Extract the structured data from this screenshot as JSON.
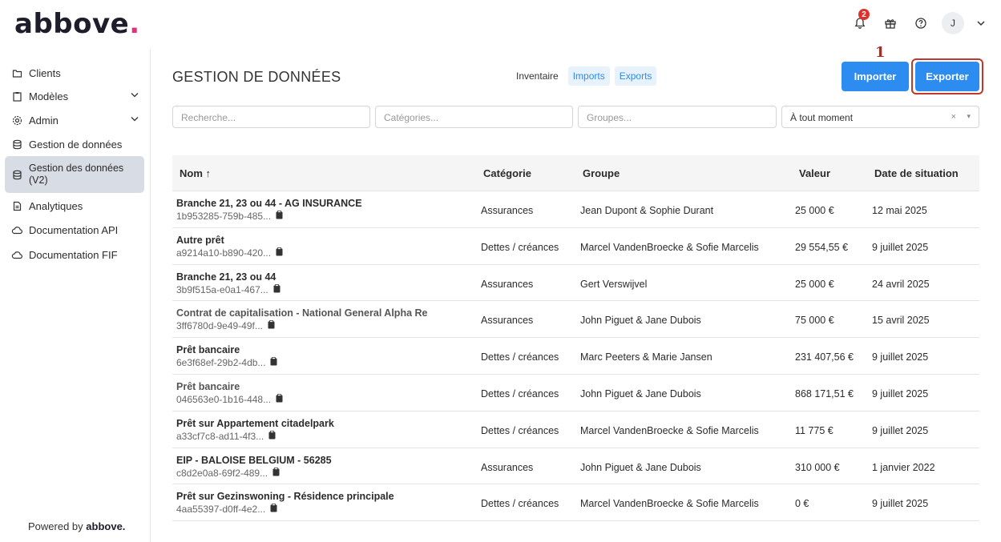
{
  "brand": {
    "name": "abbove",
    "dot": "."
  },
  "topbar": {
    "notifications_count": "2",
    "avatar_initial": "J"
  },
  "sidebar": {
    "items": [
      {
        "label": "Clients",
        "icon": "folder-icon"
      },
      {
        "label": "Modèles",
        "icon": "clipboard-icon",
        "expandable": true
      },
      {
        "label": "Admin",
        "icon": "gear-icon",
        "expandable": true
      },
      {
        "label": "Gestion de données",
        "icon": "database-icon"
      },
      {
        "label": "Gestion des données (V2)",
        "icon": "database-icon",
        "active": true
      },
      {
        "label": "Analytiques",
        "icon": "document-icon"
      },
      {
        "label": "Documentation API",
        "icon": "cloud-icon"
      },
      {
        "label": "Documentation FIF",
        "icon": "cloud-icon"
      }
    ],
    "powered_by": "Powered by",
    "powered_brand": "abbove."
  },
  "main": {
    "title": "GESTION DE DONNÉES",
    "tabs": [
      "Inventaire",
      "Imports",
      "Exports"
    ],
    "import_label": "Importer",
    "export_label": "Exporter",
    "step_marker": "1",
    "filters": {
      "search_placeholder": "Recherche...",
      "categories_placeholder": "Catégories...",
      "groups_placeholder": "Groupes...",
      "period_value": "À tout moment",
      "clear_symbol": "×",
      "caret_symbol": "▾"
    },
    "table": {
      "columns": [
        "Nom ↑",
        "Catégorie",
        "Groupe",
        "Valeur",
        "Date de situation"
      ],
      "rows": [
        {
          "name": "Branche 21, 23 ou 44 - AG INSURANCE",
          "id": "1b953285-759b-485...",
          "category": "Assurances",
          "group": "Jean Dupont & Sophie Durant",
          "value": "25 000 €",
          "date": "12 mai 2025"
        },
        {
          "name": "Autre prêt",
          "id": "a9214a10-b890-420...",
          "category": "Dettes / créances",
          "group": "Marcel VandenBroecke & Sofie Marcelis",
          "value": "29 554,55 €",
          "date": "9 juillet 2025"
        },
        {
          "name": "Branche 21, 23 ou 44",
          "id": "3b9f515a-e0a1-467...",
          "category": "Assurances",
          "group": "Gert Verswijvel",
          "value": "25 000 €",
          "date": "24 avril 2025"
        },
        {
          "name": "Contrat de capitalisation - National General Alpha Re",
          "id": "3ff6780d-9e49-49f...",
          "category": "Assurances",
          "group": "John Piguet & Jane Dubois",
          "value": "75 000 €",
          "date": "15 avril 2025"
        },
        {
          "name": "Prêt bancaire",
          "id": "6e3f68ef-29b2-4db...",
          "category": "Dettes / créances",
          "group": "Marc Peeters & Marie Jansen",
          "value": "231 407,56 €",
          "date": "9 juillet 2025"
        },
        {
          "name": "Prêt bancaire",
          "id": "046563e0-1b16-448...",
          "category": "Dettes / créances",
          "group": "John Piguet & Jane Dubois",
          "value": "868 171,51 €",
          "date": "9 juillet 2025"
        },
        {
          "name": "Prêt sur Appartement citadelpark",
          "id": "a33cf7c8-ad11-4f3...",
          "category": "Dettes / créances",
          "group": "Marcel VandenBroecke & Sofie Marcelis",
          "value": "11 775 €",
          "date": "9 juillet 2025"
        },
        {
          "name": "EIP - BALOISE BELGIUM - 56285",
          "id": "c8d2e0a8-69f2-489...",
          "category": "Assurances",
          "group": "John Piguet & Jane Dubois",
          "value": "310 000 €",
          "date": "1 janvier 2022"
        },
        {
          "name": "Prêt sur Gezinswoning - Résidence principale",
          "id": "4aa55397-d0ff-4e2...",
          "category": "Dettes / créances",
          "group": "Marcel VandenBroecke & Sofie Marcelis",
          "value": "0 €",
          "date": "9 juillet 2025"
        }
      ]
    }
  }
}
